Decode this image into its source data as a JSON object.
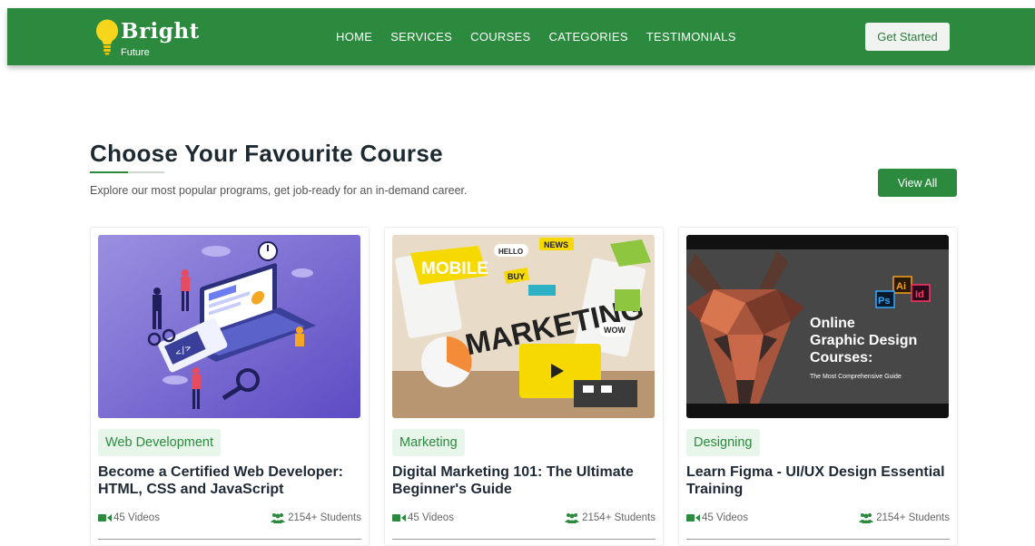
{
  "brand": {
    "name": "Bright",
    "tagline": "Future"
  },
  "nav": {
    "links": [
      "HOME",
      "SERVICES",
      "COURSES",
      "CATEGORIES",
      "TESTIMONIALS"
    ],
    "cta": "Get Started"
  },
  "section": {
    "title": "Choose Your Favourite Course",
    "subtitle": "Explore our most popular programs, get job-ready for an in-demand career.",
    "view_all": "View All"
  },
  "courses": [
    {
      "category": "Web Development",
      "title": "Become a Certified Web Developer: HTML, CSS and JavaScript",
      "videos": "45 Videos",
      "students": "2154+ Students",
      "image_icon": "web-development-illustration"
    },
    {
      "category": "Marketing",
      "title": "Digital Marketing 101: The Ultimate Beginner's Guide",
      "videos": "45 Videos",
      "students": "2154+ Students",
      "image_icon": "mobile-marketing-illustration",
      "image_text": {
        "word1": "MOBILE",
        "word2": "MARKETING",
        "tags": [
          "NEWS",
          "HELLO",
          "BUY",
          "WOW"
        ]
      }
    },
    {
      "category": "Designing",
      "title": "Learn Figma - UI/UX Design Essential Training",
      "videos": "45 Videos",
      "students": "2154+ Students",
      "image_icon": "low-poly-deer-graphic",
      "image_text": {
        "line1": "Online",
        "line2": "Graphic Design",
        "line3": "Courses:",
        "caption": "The Most Comprehensive Guide",
        "badges": [
          "Ai",
          "Ps",
          "Id"
        ]
      }
    }
  ],
  "colors": {
    "primary": "#2b8a3e",
    "badge_bg": "#e8f5ea",
    "heading": "#1e2a32"
  }
}
